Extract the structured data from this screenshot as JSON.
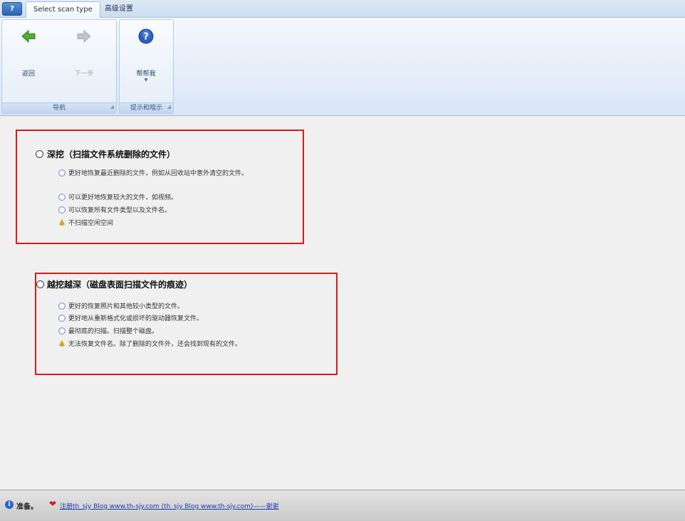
{
  "app_button": {
    "label": "?"
  },
  "tabs": [
    {
      "label": "Select scan type",
      "active": true
    },
    {
      "label": "高级设置",
      "active": false
    }
  ],
  "ribbon": {
    "nav_group": {
      "label": "导航",
      "back_label": "返回",
      "next_label": "下一步",
      "next_disabled": true
    },
    "help_group": {
      "label": "提示和暗示",
      "help_label": "帮帮我"
    }
  },
  "options": [
    {
      "title": "深挖（扫描文件系统删除的文件）",
      "selected": false,
      "bullets": [
        {
          "icon": "info-icon",
          "text": "更好地恢复最近删除的文件，例如从回收站中意外清空的文件。"
        },
        {
          "icon": "info-icon",
          "text": "可以更好地恢复较大的文件，如视频。"
        },
        {
          "icon": "info-icon",
          "text": "可以恢复所有文件类型以及文件名。"
        },
        {
          "icon": "warning-icon",
          "text": "不扫描空闲空间"
        }
      ]
    },
    {
      "title": "越挖越深（磁盘表面扫描文件的痕迹）",
      "selected": false,
      "bullets": [
        {
          "icon": "info-icon",
          "text": "更好的恢复照片和其他较小类型的文件。"
        },
        {
          "icon": "info-icon",
          "text": "更好地从重新格式化或损坏的驱动器恢复文件。"
        },
        {
          "icon": "info-icon",
          "text": "最彻底的扫描。扫描整个磁盘。"
        },
        {
          "icon": "warning-icon",
          "text": "无法恢复文件名。除了删除的文件外，还会找到现有的文件。"
        }
      ]
    }
  ],
  "status": {
    "text": "准备。",
    "link": "注册th_sjy Blog www.th-sjy.com (th_sjy Blog www.th-sjy.com)——谢谢"
  },
  "colors": {
    "highlight_border": "#e01818",
    "link": "#1d3fa8"
  }
}
